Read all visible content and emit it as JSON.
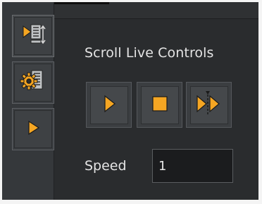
{
  "panel": {
    "heading": "Scroll Live Controls"
  },
  "sidebar": {
    "items": [
      {
        "icon": "play-document-icon"
      },
      {
        "icon": "gear-document-icon"
      },
      {
        "icon": "play-icon"
      }
    ]
  },
  "controls": {
    "play_icon": "play-icon",
    "stop_icon": "stop-icon",
    "frame_icon": "step-frame-icon"
  },
  "speed": {
    "label": "Speed",
    "value": "1"
  },
  "colors": {
    "accent": "#f5a623",
    "background": "#2a2c2e",
    "button": "#3b3e41",
    "text": "#e4e4e4"
  }
}
